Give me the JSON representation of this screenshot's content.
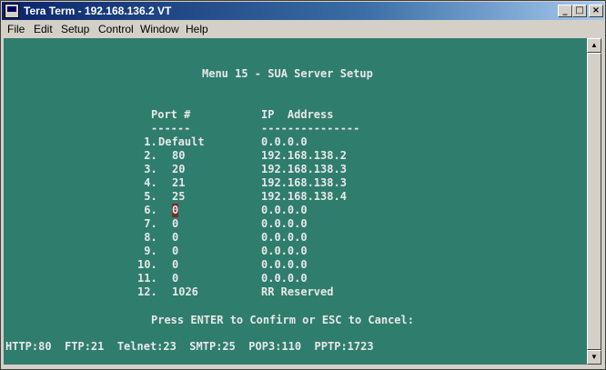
{
  "window": {
    "title": "Tera Term - 192.168.136.2 VT"
  },
  "menu": [
    "File",
    "Edit",
    "Setup",
    "Control",
    "Window",
    "Help"
  ],
  "terminal": {
    "heading": "Menu 15 - SUA Server Setup",
    "col_port": "Port #",
    "col_ip": "IP  Address",
    "sep_port": "------",
    "sep_ip": "---------------",
    "rows": [
      {
        "n": " 1.",
        "port": "Default",
        "ip": "0.0.0.0"
      },
      {
        "n": " 2.",
        "port": "80",
        "ip": "192.168.138.2"
      },
      {
        "n": " 3.",
        "port": "20",
        "ip": "192.168.138.3"
      },
      {
        "n": " 4.",
        "port": "21",
        "ip": "192.168.138.3"
      },
      {
        "n": " 5.",
        "port": "25",
        "ip": "192.168.138.4"
      },
      {
        "n": " 6.",
        "port": "0",
        "ip": "0.0.0.0"
      },
      {
        "n": " 7.",
        "port": "0",
        "ip": "0.0.0.0"
      },
      {
        "n": " 8.",
        "port": "0",
        "ip": "0.0.0.0"
      },
      {
        "n": " 9.",
        "port": "0",
        "ip": "0.0.0.0"
      },
      {
        "n": "10.",
        "port": "0",
        "ip": "0.0.0.0"
      },
      {
        "n": "11.",
        "port": "0",
        "ip": "0.0.0.0"
      },
      {
        "n": "12.",
        "port": "1026",
        "ip": "RR Reserved"
      }
    ],
    "prompt": "Press ENTER to Confirm or ESC to Cancel:",
    "footer": "HTTP:80  FTP:21  Telnet:23  SMTP:25  POP3:110  PPTP:1723"
  }
}
